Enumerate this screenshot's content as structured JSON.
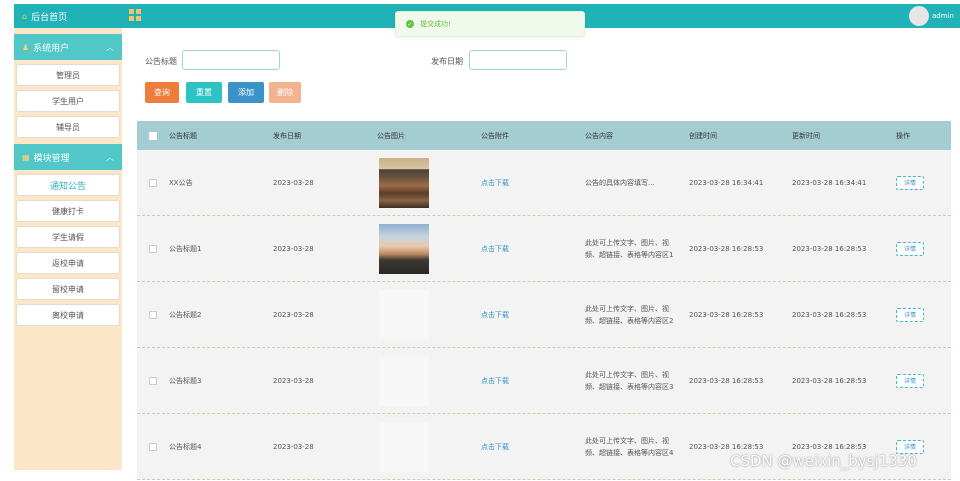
{
  "sidebar": {
    "home": "后台首页",
    "groups": [
      {
        "title": "系统用户",
        "items": [
          "管理员",
          "学生用户",
          "辅导员"
        ]
      },
      {
        "title": "模块管理",
        "items": [
          "通知公告",
          "健康打卡",
          "学生请假",
          "返校申请",
          "留校申请",
          "离校申请"
        ]
      }
    ],
    "active_item": "通知公告"
  },
  "topbar": {
    "user": "admin"
  },
  "toast": {
    "message": "提交成功!"
  },
  "search": {
    "title_label": "公告标题",
    "title_value": "",
    "date_label": "发布日期",
    "date_value": ""
  },
  "buttons": {
    "query": "查询",
    "reset": "重置",
    "add": "添加",
    "delete": "删除"
  },
  "table": {
    "headers": [
      "公告标题",
      "发布日期",
      "公告图片",
      "公告附件",
      "公告内容",
      "创建时间",
      "更新时间",
      "操作"
    ],
    "rows": [
      {
        "title": "XX公告",
        "date": "2023-03-28",
        "image": "photo-classroom",
        "attach": "点击下载",
        "content_1": "公告的具体内容填写...",
        "content_2": "",
        "created": "2023-03-28 16:34:41",
        "updated": "2023-03-28 16:34:41",
        "action": "详情"
      },
      {
        "title": "公告标题1",
        "date": "2023-03-28",
        "image": "photo-sky",
        "attach": "点击下载",
        "content_1": "此处可上传文字、图片、视",
        "content_2": "频、超链接、表格等内容区1",
        "created": "2023-03-28 16:28:53",
        "updated": "2023-03-28 16:28:53",
        "action": "详情"
      },
      {
        "title": "公告标题2",
        "date": "2023-03-28",
        "image": "",
        "attach": "点击下载",
        "content_1": "此处可上传文字、图片、视",
        "content_2": "频、超链接、表格等内容区2",
        "created": "2023-03-28 16:28:53",
        "updated": "2023-03-28 16:28:53",
        "action": "详情"
      },
      {
        "title": "公告标题3",
        "date": "2023-03-28",
        "image": "",
        "attach": "点击下载",
        "content_1": "此处可上传文字、图片、视",
        "content_2": "频、超链接、表格等内容区3",
        "created": "2023-03-28 16:28:53",
        "updated": "2023-03-28 16:28:53",
        "action": "详情"
      },
      {
        "title": "公告标题4",
        "date": "2023-03-28",
        "image": "",
        "attach": "点击下载",
        "content_1": "此处可上传文字、图片、视",
        "content_2": "频、超链接、表格等内容区4",
        "created": "2023-03-28 16:28:53",
        "updated": "2023-03-28 16:28:53",
        "action": "详情"
      }
    ]
  },
  "watermark": "CSDN @weixin_bysj1330",
  "colors": {
    "teal": "#1fb3b7",
    "sidebar_bg": "#fbe7c8",
    "orange": "#ee7c3b",
    "blue": "#3c93c8"
  }
}
